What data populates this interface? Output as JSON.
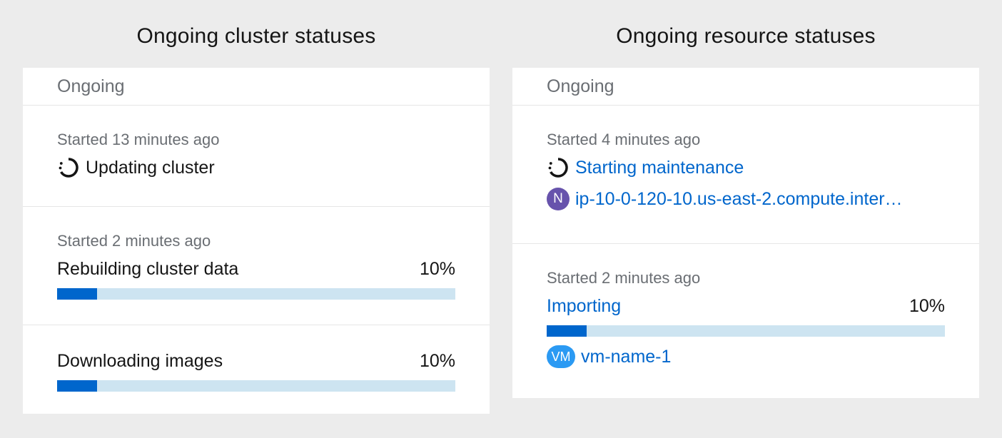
{
  "left_panel": {
    "title": "Ongoing cluster statuses",
    "header": "Ongoing",
    "items": [
      {
        "started": "Started 13 minutes ago",
        "label": "Updating cluster"
      },
      {
        "started": "Started 2 minutes ago",
        "label": "Rebuilding cluster data",
        "percent": "10%",
        "progress": 0.1
      },
      {
        "label": "Downloading images",
        "percent": "10%",
        "progress": 0.1
      }
    ]
  },
  "right_panel": {
    "title": "Ongoing resource statuses",
    "header": "Ongoing",
    "items": [
      {
        "started": "Started 4 minutes ago",
        "label": "Starting maintenance",
        "resource_badge": "N",
        "resource": "ip-10-0-120-10.us-east-2.compute.inter…"
      },
      {
        "started": "Started 2 minutes ago",
        "label": "Importing",
        "percent": "10%",
        "progress": 0.1,
        "resource_badge": "VM",
        "resource": "vm-name-1"
      }
    ]
  },
  "colors": {
    "background": "#ececec",
    "card": "#ffffff",
    "link": "#0066cc",
    "progress_fill": "#0066cc",
    "progress_track": "#cde4f1",
    "badge_node": "#6753ac",
    "badge_vm": "#2b9af3"
  },
  "icons": {
    "in_progress": "spinner-icon"
  }
}
